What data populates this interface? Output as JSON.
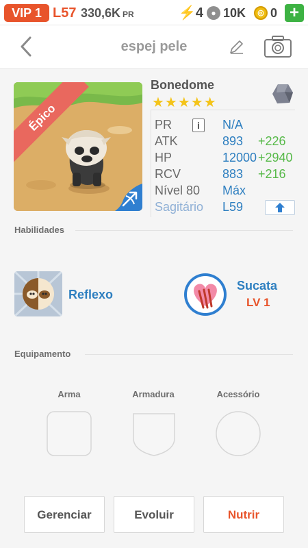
{
  "status": {
    "vip": "VIP 1",
    "level": "L57",
    "pr_value": "330,6K",
    "pr_unit": "PR",
    "energy": "4",
    "paw_count": "10K",
    "coins": "0",
    "plus": "+"
  },
  "header": {
    "title": "espej pele"
  },
  "pet": {
    "rarity": "Épico",
    "name": "Bonedome",
    "stars": "★★★★★",
    "stars_count": 5,
    "stats": {
      "pr_label": "PR",
      "pr_info": "i",
      "pr_value": "N/A",
      "atk_label": "ATK",
      "atk_value": "893",
      "atk_bonus": "+226",
      "hp_label": "HP",
      "hp_value": "12000",
      "hp_bonus": "+2940",
      "rcv_label": "RCV",
      "rcv_value": "883",
      "rcv_bonus": "+216",
      "level_label": "Nível 80",
      "level_value": "Máx",
      "class_label": "Sagitário",
      "class_value": "L59"
    }
  },
  "skills": {
    "heading": "Habilidades",
    "items": [
      {
        "name": "Reflexo"
      },
      {
        "name": "Sucata",
        "level": "LV 1"
      }
    ]
  },
  "equipment": {
    "heading": "Equipamento",
    "slots": [
      {
        "label": "Arma"
      },
      {
        "label": "Armadura"
      },
      {
        "label": "Acessório"
      }
    ]
  },
  "actions": {
    "manage": "Gerenciar",
    "evolve": "Evoluir",
    "feed": "Nutrir"
  },
  "colors": {
    "accent_orange": "#e8542b",
    "link_blue": "#2e7fc0",
    "bonus_green": "#56b948",
    "star_yellow": "#f4c41a"
  },
  "icons": {
    "back": "chevron-left-icon",
    "edit": "pencil-icon",
    "camera": "camera-icon",
    "element": "rock-icon",
    "class": "sagittarius-bow-icon",
    "upgrade": "arrow-up-icon",
    "skill1": "reflex-skill-icon",
    "skill2": "scrap-heart-skill-icon"
  }
}
